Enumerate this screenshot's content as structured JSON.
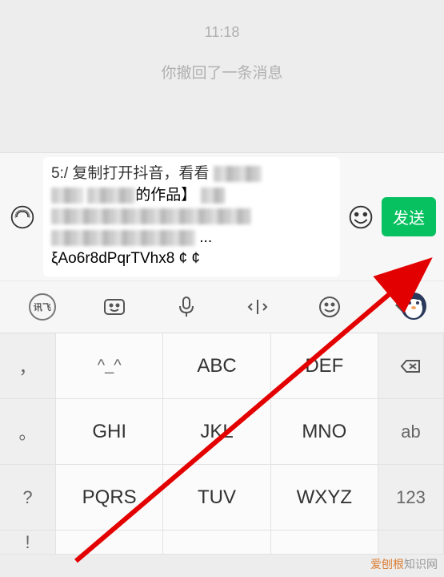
{
  "chat": {
    "timestamp": "11:18",
    "recall_notice": "你撤回了一条消息"
  },
  "input": {
    "line_prefix": "5:/ 复制打开抖音，看看",
    "line_suffix": "的作品】",
    "visible_tail": "ξAo6r8dPqrTVhx8 ¢ ¢",
    "send_label": "发送"
  },
  "toolbar": {
    "ime_badge": "讯飞",
    "icons": {
      "keyboard_face": "keyboard-face-icon",
      "mic": "microphone-icon",
      "cursor": "cursor-move-icon",
      "smile": "smile-icon",
      "collapse": "chevron-down-icon"
    }
  },
  "keyboard": {
    "row1": {
      "side": "，",
      "k1_face": "^_^",
      "k2": "ABC",
      "k3": "DEF"
    },
    "row2": {
      "side": "。",
      "k1": "GHI",
      "k2": "JKL",
      "k3": "MNO",
      "right": "ab"
    },
    "row3": {
      "side": "?",
      "k1": "PQRS",
      "k2": "TUV",
      "k3": "WXYZ",
      "right": "123"
    },
    "row4_side": "!"
  },
  "watermark": {
    "brand": "爱刨根",
    "suffix": "知识网"
  }
}
